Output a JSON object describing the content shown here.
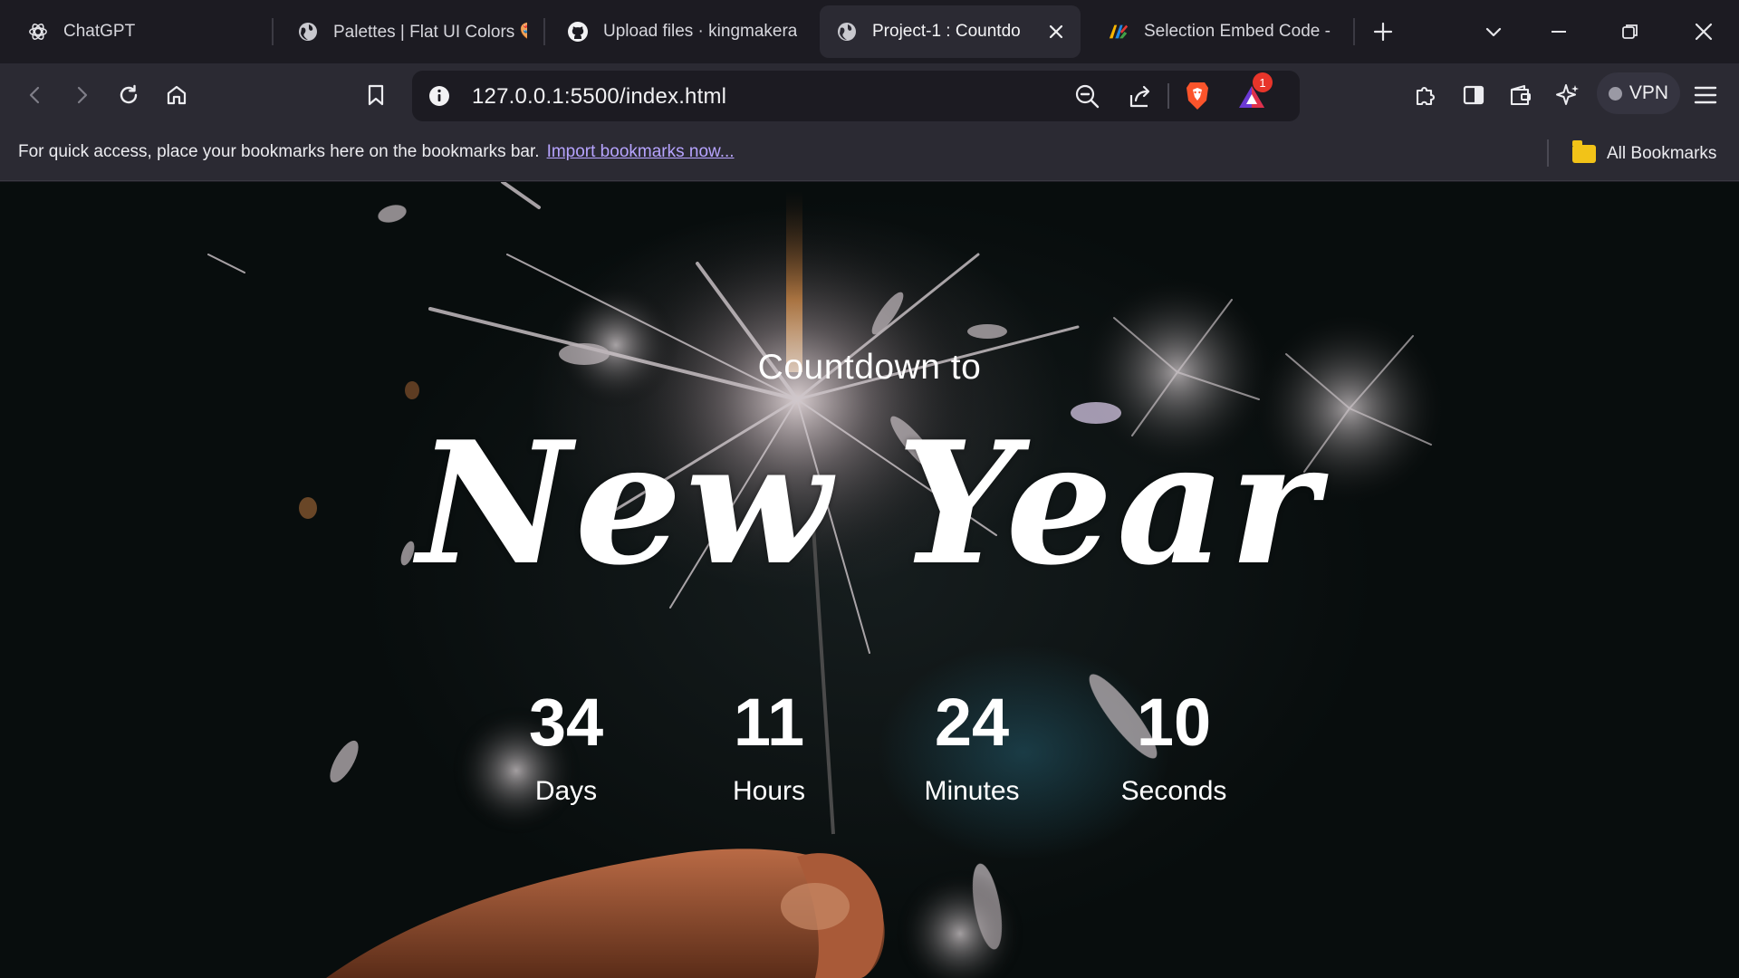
{
  "tabs": [
    {
      "title": "ChatGPT",
      "icon": "chatgpt-icon"
    },
    {
      "title": "Palettes | Flat UI Colors 🎨",
      "icon": "globe-icon"
    },
    {
      "title": "Upload files · kingmakera",
      "icon": "github-icon"
    },
    {
      "title": "Project-1 : Countdo",
      "icon": "globe-icon",
      "active": true
    },
    {
      "title": "Selection Embed Code - ",
      "icon": "colorful-logo-icon"
    }
  ],
  "toolbar": {
    "url": "127.0.0.1:5500/index.html",
    "notification_count": "1",
    "vpn_label": "VPN"
  },
  "bookmarks_bar": {
    "message": "For quick access, place your bookmarks here on the bookmarks bar.",
    "import_link": "Import bookmarks now...",
    "all_bookmarks": "All Bookmarks"
  },
  "page": {
    "subtitle": "Countdown to",
    "title": "New Year",
    "countdown": [
      {
        "value": "34",
        "label": "Days"
      },
      {
        "value": "11",
        "label": "Hours"
      },
      {
        "value": "24",
        "label": "Minutes"
      },
      {
        "value": "10",
        "label": "Seconds"
      }
    ]
  },
  "colors": {
    "tabstrip_bg": "#1c1b22",
    "toolbar_bg": "#2b2a33",
    "link": "#b7a4ff",
    "brave_orange": "#fb542b",
    "folder_yellow": "#f2c318"
  }
}
